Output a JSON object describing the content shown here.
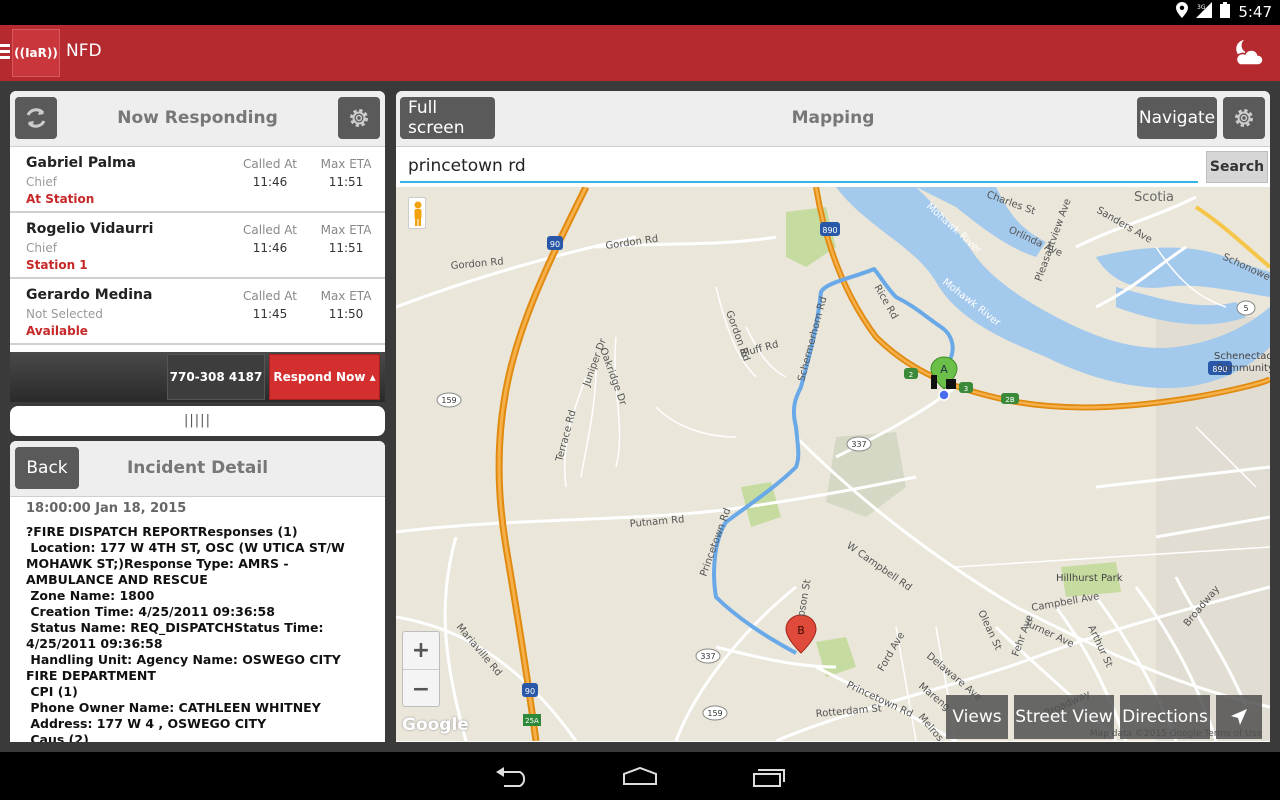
{
  "status_bar": {
    "time": "5:47",
    "network": "3G"
  },
  "app": {
    "title": "NFD",
    "logo_text": "((IaR))"
  },
  "responding": {
    "title": "Now Responding",
    "col_called": "Called At",
    "col_eta": "Max ETA",
    "items": [
      {
        "name": "Gabriel Palma",
        "role": "Chief",
        "status": "At Station",
        "called": "11:46",
        "eta": "11:51"
      },
      {
        "name": "Rogelio Vidaurri",
        "role": "Chief",
        "status": "Station 1",
        "called": "11:46",
        "eta": "11:51"
      },
      {
        "name": "Gerardo Medina",
        "role": "Not Selected",
        "status": "Available",
        "called": "11:45",
        "eta": "11:50"
      }
    ],
    "phone": "770-308 4187",
    "respond_label": "Respond Now ▴",
    "grip": "|||||"
  },
  "incident": {
    "title": "Incident Detail",
    "back_label": "Back",
    "time": "18:00:00 Jan 18, 2015",
    "lines": [
      "?FIRE DISPATCH REPORTResponses (1)",
      " Location: 177 W 4TH ST, OSC (W UTICA ST/W MOHAWK ST;)Response Type: AMRS - AMBULANCE AND RESCUE",
      " Zone Name: 1800",
      " Creation Time: 4/25/2011 09:36:58",
      " Status Name: REQ_DISPATCHStatus Time: 4/25/2011 09:36:58",
      " Handling Unit: Agency Name: OSWEGO CITY FIRE DEPARTMENT",
      " CPI (1)",
      " Phone Owner Name: CATHLEEN WHITNEY",
      " Address: 177 W 4 , OSWEGO CITY",
      " Caus (2)"
    ]
  },
  "mapping": {
    "title": "Mapping",
    "fullscreen_label": "Full screen",
    "navigate_label": "Navigate",
    "search_value": "princetown rd",
    "search_label": "Search",
    "views_label": "Views",
    "street_view_label": "Street View",
    "directions_label": "Directions",
    "zoom_in": "+",
    "zoom_out": "−",
    "google_logo": "Google",
    "legal": "Map data ©2015 Google   Terms of Use",
    "marker_a": "A",
    "marker_b": "B",
    "labels": {
      "scotia": "Scotia",
      "mohawk_river_1": "Mohawk River",
      "mohawk_river_2": "Mohawk River",
      "charles_st": "Charles St",
      "sanders_ave": "Sanders Ave",
      "orlinda_ave": "Orlinda Ave",
      "pleasantview_ave": "Pleasantview Ave",
      "schonowe": "Schonowe",
      "schenectady": "Schenectad",
      "community": "Community",
      "gordon_rd_1": "Gordon Rd",
      "gordon_rd_2": "Gordon Rd",
      "gordon_rd_3": "Gordon Rd",
      "rice_rd": "Rice Rd",
      "schermerhorn_rd": "Schermerhorn Rd",
      "bluff_rd": "Bluff Rd",
      "oakridge_dr": "Oakridge Dr",
      "juniper_dr": "Juniper Dr",
      "terrace_rd": "Terrace Rd",
      "putnam_rd": "Putnam Rd",
      "princetown_rd_1": "Princetown Rd",
      "princetown_rd_2": "Princetown Rd",
      "w_campbell_rd": "W Campbell Rd",
      "campbell_ave": "Campbell Ave",
      "hillhurst_park": "Hillhurst Park",
      "turner_ave": "Turner Ave",
      "olean_st": "Olean St",
      "fehr_ave": "Fehr Ave",
      "arthur_st": "Arthur St",
      "broadway_1": "Broadway",
      "broadway_2": "Broadway",
      "mariaville_rd": "Mariaville Rd",
      "ford_ave": "Ford Ave",
      "delaware_ave": "Delaware Ave",
      "marengo": "Mareng",
      "melrose": "Melros",
      "rotterdam_st": "Rotterdam St",
      "simpson_st": "pson St",
      "i90_a": "90",
      "i90_b": "90",
      "r890_a": "890",
      "r890_b": "890",
      "r159_a": "159",
      "r159_b": "159",
      "r337_a": "337",
      "r337_b": "337",
      "r25a": "25A",
      "r5": "5",
      "x2": "2",
      "x3": "3",
      "x2b": "2B"
    }
  },
  "colors": {
    "app_bar": "#b52a2f",
    "route": "#6aa9e8",
    "highway": "#f29c1e",
    "water": "#a3c9ec",
    "park": "#c6dba0",
    "respond_button": "#d32f2f",
    "status_red": "#c62828"
  }
}
